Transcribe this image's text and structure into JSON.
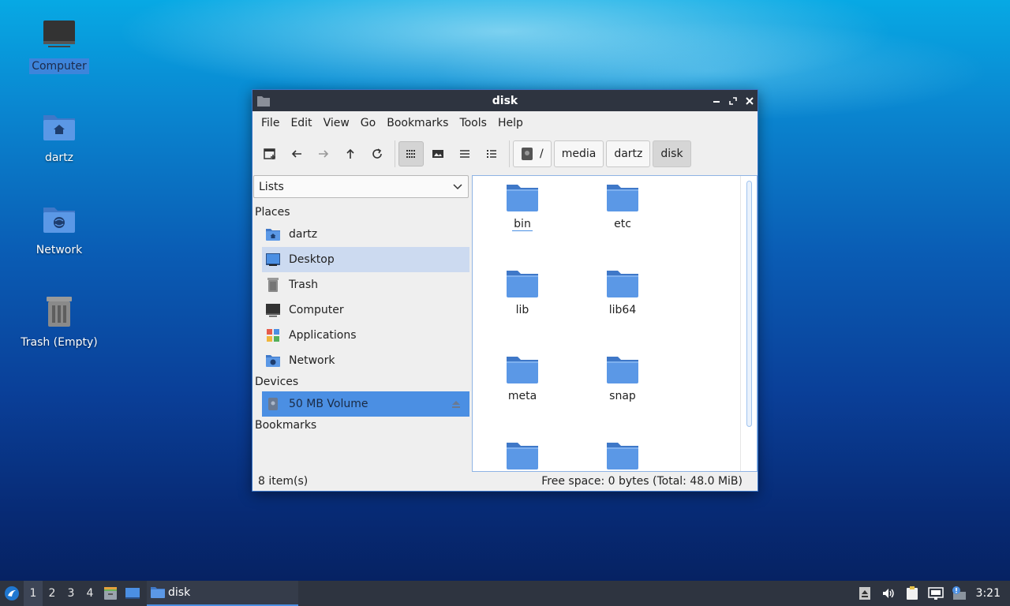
{
  "desktop": {
    "icons": [
      {
        "label": "Computer"
      },
      {
        "label": "dartz"
      },
      {
        "label": "Network"
      },
      {
        "label": "Trash (Empty)"
      }
    ]
  },
  "window": {
    "title": "disk",
    "menu": [
      "File",
      "Edit",
      "View",
      "Go",
      "Bookmarks",
      "Tools",
      "Help"
    ],
    "breadcrumb": [
      "/",
      "media",
      "dartz",
      "disk"
    ],
    "sidebar": {
      "selector": "Lists",
      "places_heading": "Places",
      "places": [
        "dartz",
        "Desktop",
        "Trash",
        "Computer",
        "Applications",
        "Network"
      ],
      "devices_heading": "Devices",
      "devices": [
        "50 MB Volume"
      ],
      "bookmarks_heading": "Bookmarks"
    },
    "files": [
      "bin",
      "etc",
      "lib",
      "lib64",
      "meta",
      "snap"
    ],
    "status": {
      "items": "8 item(s)",
      "free_space": "Free space: 0 bytes (Total: 48.0 MiB)"
    }
  },
  "taskbar": {
    "workspaces": [
      "1",
      "2",
      "3",
      "4"
    ],
    "task": "disk",
    "clock": "3:21"
  },
  "colors": {
    "accent": "#4b8fe3",
    "titlebar": "#2e3440",
    "folder": "#4a86d8"
  }
}
